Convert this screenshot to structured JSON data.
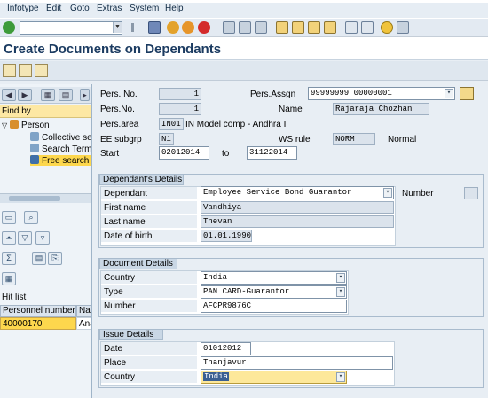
{
  "menu": {
    "items": [
      "Infotype",
      "Edit",
      "Goto",
      "Extras",
      "System",
      "Help"
    ]
  },
  "toolbar": {
    "command_value": "",
    "icons": [
      "enter-icon",
      "save-icon",
      "back-icon",
      "exit-icon",
      "cancel-icon",
      "print-icon",
      "find-icon",
      "find-next-icon",
      "first-page-icon",
      "prev-page-icon",
      "next-page-icon",
      "last-page-icon",
      "create-session-icon",
      "shortcut-icon",
      "help-icon",
      "customize-icon"
    ]
  },
  "title": "Create Documents on Dependants",
  "left_panel": {
    "find_by": "Find by",
    "tree": [
      {
        "label": "Person",
        "icon": "person-tree-icon"
      },
      {
        "label": "Collective sea",
        "icon": "collective-search-icon"
      },
      {
        "label": "Search Term",
        "icon": "search-term-icon"
      },
      {
        "label": "Free search",
        "icon": "free-search-icon"
      }
    ],
    "hit_list_label": "Hit list",
    "hit_list": {
      "columns": [
        "Personnel number",
        "Na"
      ],
      "rows": [
        [
          "40000170",
          "Ana"
        ]
      ]
    }
  },
  "header": {
    "pers_no_label": "Pers. No.",
    "pers_no_value": "1",
    "pers_no2_label": "Pers.No.",
    "pers_no2_value": "1",
    "pers_assgn_label": "Pers.Assgn",
    "pers_assgn_value": "99999999 00000001",
    "name_label": "Name",
    "name_value": "Rajaraja Chozhan",
    "pers_area_label": "Pers.area",
    "pers_area_code": "IN01",
    "pers_area_text": "IN Model comp - Andhra I",
    "ee_subgrp_label": "EE subgrp",
    "ee_subgrp_value": "N1",
    "ws_rule_label": "WS rule",
    "ws_rule_value": "NORM",
    "ws_rule_text": "Normal",
    "start_label": "Start",
    "start_value": "02012014",
    "to_label": "to",
    "to_value": "31122014"
  },
  "dependants": {
    "title": "Dependant's Details",
    "dependant_label": "Dependant",
    "dependant_value": "Employee Service Bond Guarantor",
    "number_label": "Number",
    "first_name_label": "First name",
    "first_name_value": "Vandhiya",
    "last_name_label": "Last name",
    "last_name_value": "Thevan",
    "dob_label": "Date of birth",
    "dob_value": "01.01.1990"
  },
  "document": {
    "title": "Document Details",
    "country_label": "Country",
    "country_value": "India",
    "type_label": "Type",
    "type_value": "PAN CARD-Guarantor",
    "number_label": "Number",
    "number_value": "AFCPR9876C"
  },
  "issue": {
    "title": "Issue Details",
    "date_label": "Date",
    "date_value": "01012012",
    "place_label": "Place",
    "place_value": "Thanjavur",
    "country_label": "Country",
    "country_value": "India"
  },
  "colors": {
    "title": "#1b3b61",
    "highlight": "#fdd74d",
    "group_tab": "#c9d7e5"
  }
}
